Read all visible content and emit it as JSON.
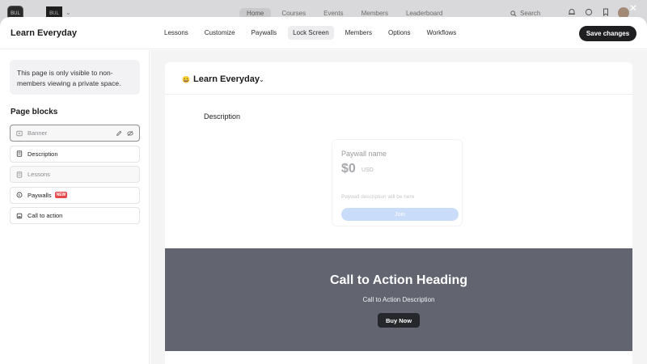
{
  "background_app": {
    "logo_text": "BUL",
    "workspace_text": "BUL",
    "nav": [
      "Home",
      "Courses",
      "Events",
      "Members",
      "Leaderboard"
    ],
    "active_nav_index": 0,
    "search_label": "Search"
  },
  "modal": {
    "title": "Learn Everyday",
    "tabs": [
      "Lessons",
      "Customize",
      "Paywalls",
      "Lock Screen",
      "Members",
      "Options",
      "Workflows"
    ],
    "active_tab_index": 3,
    "save_label": "Save changes",
    "close_glyph": "✕"
  },
  "sidebar": {
    "notice": "This page is only visible to non-members viewing a private space.",
    "heading": "Page blocks",
    "blocks": [
      {
        "label": "Banner",
        "icon": "banner-icon",
        "state": "selected"
      },
      {
        "label": "Description",
        "icon": "description-icon",
        "state": "normal"
      },
      {
        "label": "Lessons",
        "icon": "lessons-icon",
        "state": "dim"
      },
      {
        "label": "Paywalls",
        "icon": "paywall-icon",
        "state": "normal",
        "badge": "NEW"
      },
      {
        "label": "Call to action",
        "icon": "call-to-action-icon",
        "state": "normal"
      }
    ]
  },
  "preview": {
    "space_emoji": "😀",
    "space_name": "Learn Everyday",
    "description_label": "Description",
    "paywall": {
      "name": "Paywall name",
      "price": "$0",
      "currency": "USD",
      "description": "Paywall description will be here",
      "join_label": "Join"
    },
    "cta": {
      "heading": "Call to Action Heading",
      "description": "Call to Action Description",
      "button_label": "Buy Now"
    }
  },
  "colors": {
    "primary_button": "#1f1f21",
    "cta_background": "#626570",
    "join_button": "#c9dcfa",
    "new_badge": "#e5484d"
  }
}
